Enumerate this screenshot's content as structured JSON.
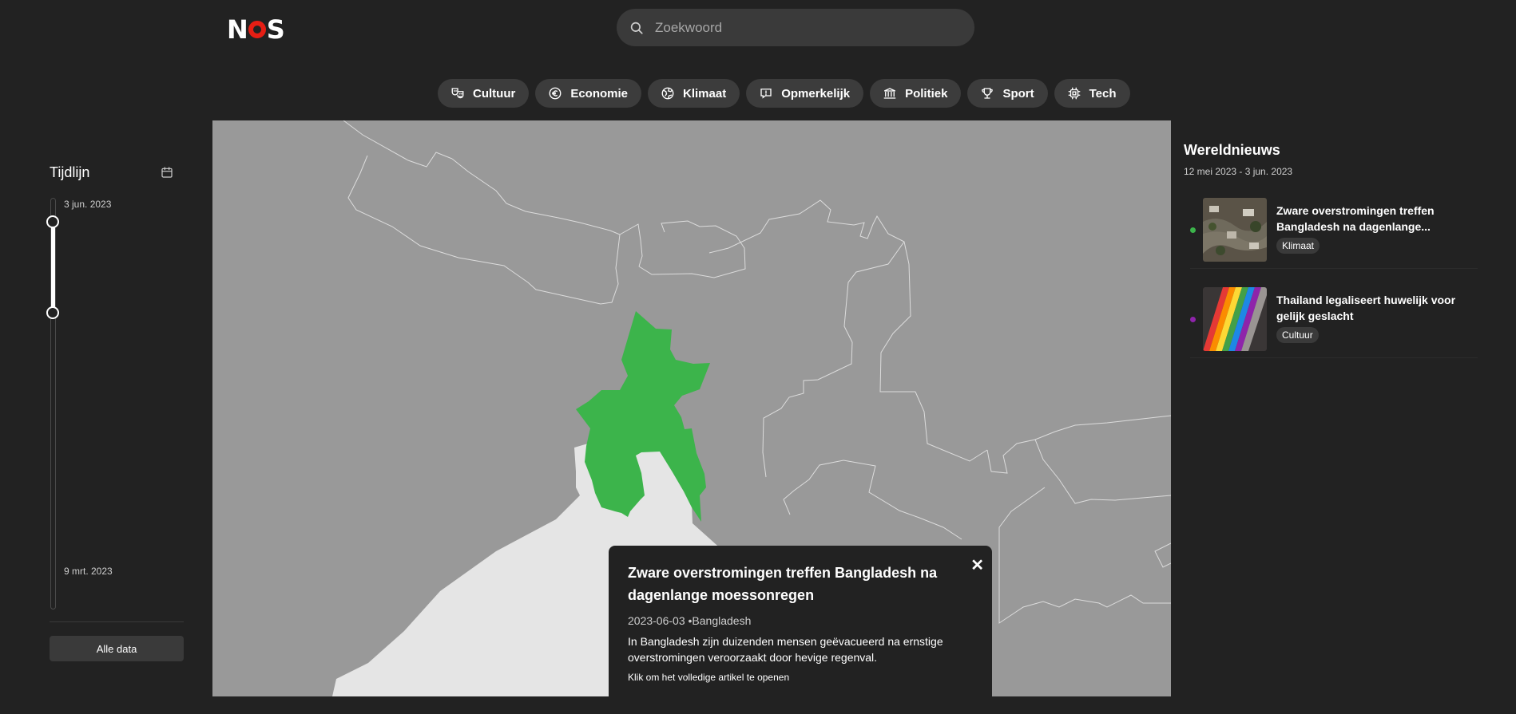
{
  "header": {
    "logo_text": "NOS",
    "search_placeholder": "Zoekwoord",
    "search_icon": "search-icon",
    "brand_red": "#e61e14"
  },
  "categories": [
    {
      "label": "Cultuur",
      "icon": "theater-masks-icon"
    },
    {
      "label": "Economie",
      "icon": "euro-icon"
    },
    {
      "label": "Klimaat",
      "icon": "globe-icon"
    },
    {
      "label": "Opmerkelijk",
      "icon": "alert-message-icon"
    },
    {
      "label": "Politiek",
      "icon": "parliament-icon"
    },
    {
      "label": "Sport",
      "icon": "trophy-icon"
    },
    {
      "label": "Tech",
      "icon": "cpu-icon"
    }
  ],
  "timeline": {
    "title": "Tijdlijn",
    "icon": "calendar-icon",
    "end_date": "3 jun. 2023",
    "start_date": "9 mrt. 2023",
    "all_data_label": "Alle data"
  },
  "map": {
    "land_color": "#999999",
    "water_color": "#e5e5e5",
    "highlight_color": "#3cb44b",
    "highlighted_country": "Bangladesh"
  },
  "popup": {
    "title": "Zware overstromingen treffen Bangladesh na dagenlange moessonregen",
    "date": "2023-06-03",
    "location": "Bangladesh",
    "separator": " •",
    "description": "In Bangladesh zijn duizenden mensen geëvacueerd na ernstige overstromingen veroorzaakt door hevige regenval.",
    "cta": "Klik om het volledige artikel te openen",
    "close_label": "✕"
  },
  "world_news": {
    "title": "Wereldnieuws",
    "range": "12 mei 2023 - 3 jun. 2023",
    "items": [
      {
        "title": "Zware overstromingen treffen Bangladesh na dagenlange...",
        "tag": "Klimaat",
        "dot_color": "#3cb44b"
      },
      {
        "title": "Thailand legaliseert huwelijk voor gelijk geslacht",
        "tag": "Cultuur",
        "dot_color": "#8e24aa"
      }
    ]
  }
}
